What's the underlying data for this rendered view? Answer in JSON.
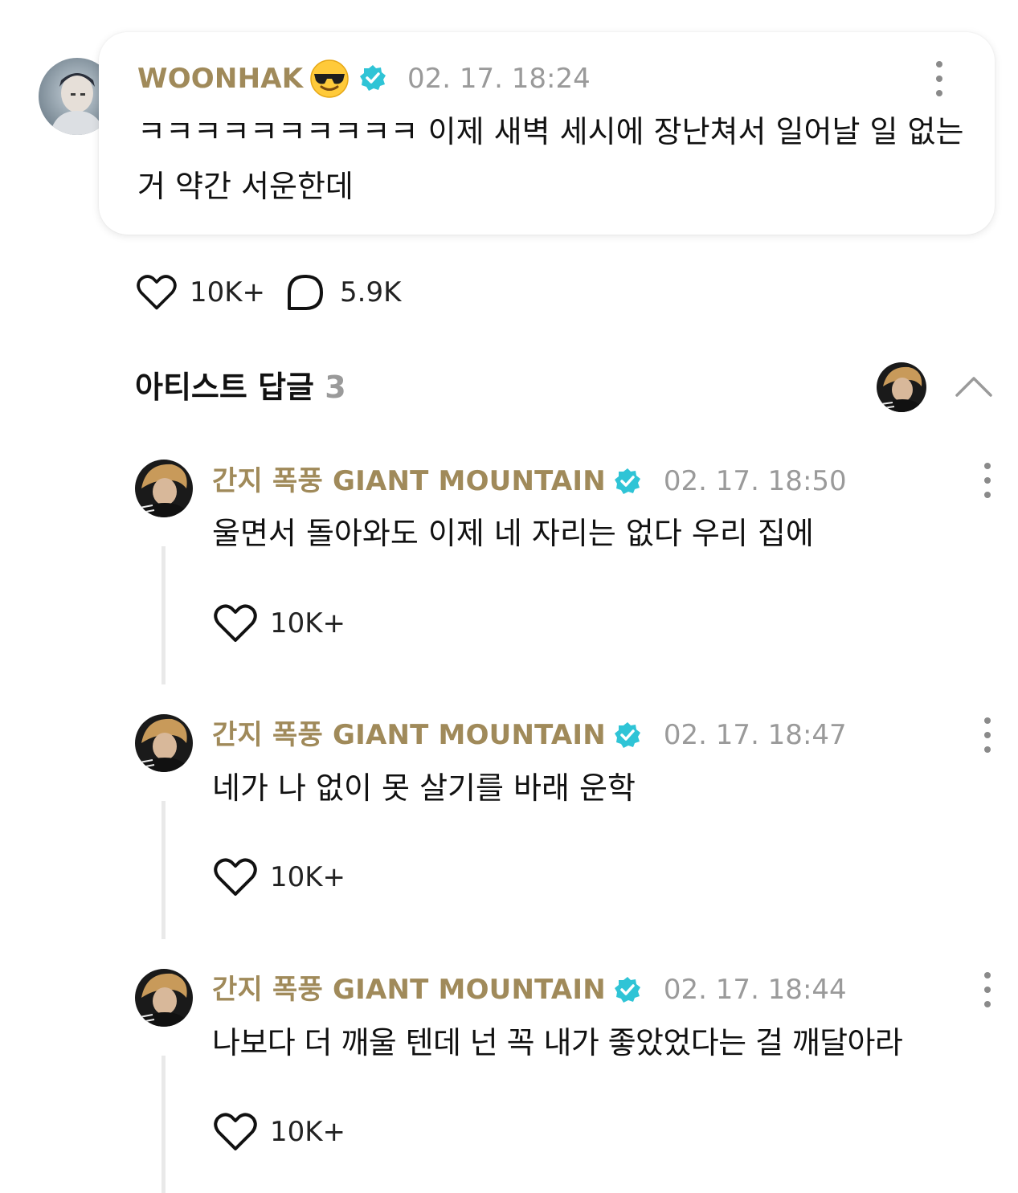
{
  "post": {
    "author": "WOONHAK",
    "author_emoji_icon": "smiling-face-with-sunglasses-icon",
    "verified_icon": "verified-badge-icon",
    "timestamp": "02. 17. 18:24",
    "text": "ㅋㅋㅋㅋㅋㅋㅋㅋㅋㅋ 이제 새벽 세시에 장난쳐서 일어날 일 없는 거 약간 서운한데",
    "likes": "10K+",
    "comments": "5.9K"
  },
  "artist_replies": {
    "title": "아티스트 답글",
    "count": "3",
    "collapse_icon": "chevron-up-icon",
    "items": [
      {
        "author": "간지 폭풍 GIANT MOUNTAIN",
        "timestamp": "02. 17. 18:50",
        "text": "울면서 돌아와도 이제 네 자리는 없다 우리 집에",
        "likes": "10K+"
      },
      {
        "author": "간지 폭풍 GIANT MOUNTAIN",
        "timestamp": "02. 17. 18:47",
        "text": "네가 나 없이 못 살기를 바래 운학",
        "likes": "10K+"
      },
      {
        "author": "간지 폭풍 GIANT MOUNTAIN",
        "timestamp": "02. 17. 18:44",
        "text": "나보다 더 깨울 텐데 넌 꼭 내가 좋았었다는 걸 깨달아라",
        "likes": "10K+"
      }
    ]
  },
  "colors": {
    "name_gold": "#a08a5a",
    "verified_teal": "#2fc4d6",
    "timestamp_gray": "#9a9a9a"
  }
}
